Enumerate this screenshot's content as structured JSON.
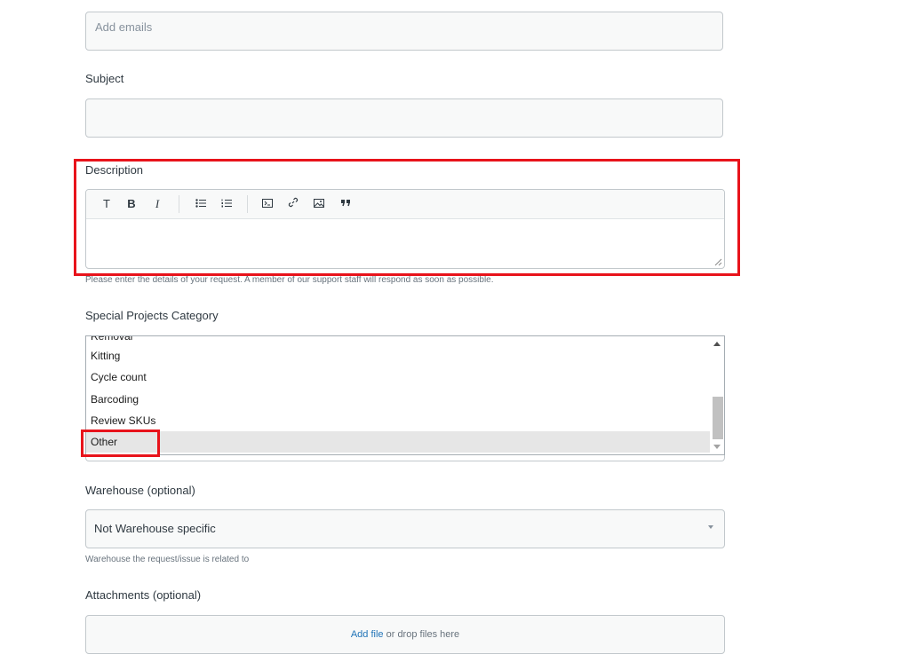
{
  "cc": {
    "placeholder": "Add emails"
  },
  "subject": {
    "label": "Subject",
    "value": ""
  },
  "description": {
    "label": "Description",
    "toolbar": {
      "text_button": "T",
      "bold_button": "B",
      "italic_button": "I"
    },
    "hint": "Please enter the details of your request. A member of our support staff will respond as soon as possible."
  },
  "category": {
    "label": "Special Projects Category",
    "options": [
      "Removal",
      "Kitting",
      "Cycle count",
      "Barcoding",
      "Review SKUs",
      "Other"
    ],
    "selected": "Other"
  },
  "warehouse": {
    "label": "Warehouse (optional)",
    "value": "Not Warehouse specific",
    "hint": "Warehouse the request/issue is related to"
  },
  "attachments": {
    "label": "Attachments (optional)",
    "add_file": "Add file",
    "drop_text": " or drop files here"
  },
  "colors": {
    "highlight": "#e8131b",
    "link": "#1f73b7"
  }
}
